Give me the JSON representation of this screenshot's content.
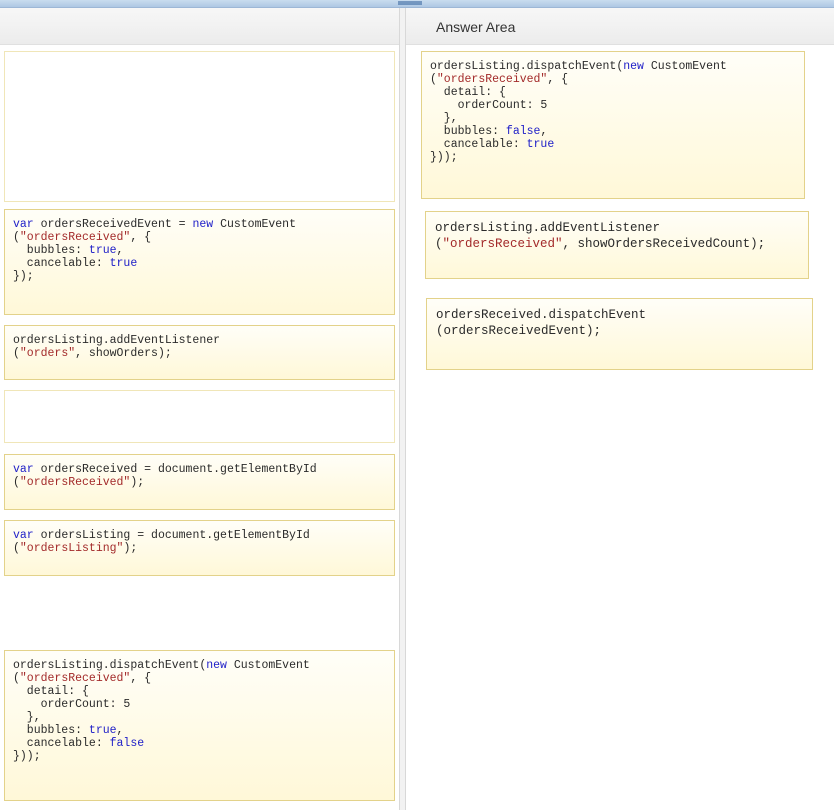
{
  "answer_area": {
    "title": "Answer Area"
  },
  "source_items": [
    {
      "lines": []
    },
    {
      "lines": [
        [
          [
            "var",
            "kw"
          ],
          [
            " ordersReceivedEvent = ",
            ""
          ],
          [
            "new",
            "kw"
          ],
          [
            " CustomEvent",
            ""
          ]
        ],
        [
          [
            "(",
            ""
          ],
          [
            "\"ordersReceived\"",
            "str"
          ],
          [
            ", {",
            ""
          ]
        ],
        [
          [
            "  bubbles: ",
            ""
          ],
          [
            "true",
            "kw"
          ],
          [
            ",",
            ""
          ]
        ],
        [
          [
            "  cancelable: ",
            ""
          ],
          [
            "true",
            "kw"
          ]
        ],
        [
          [
            "});",
            ""
          ]
        ]
      ]
    },
    {
      "lines": [
        [
          [
            "ordersListing.addEventListener",
            ""
          ]
        ],
        [
          [
            "(",
            ""
          ],
          [
            "\"orders\"",
            "str"
          ],
          [
            ", showOrders);",
            ""
          ]
        ]
      ]
    },
    {
      "lines": []
    },
    {
      "lines": [
        [
          [
            "var",
            "kw"
          ],
          [
            " ordersReceived = document.getElementById",
            ""
          ]
        ],
        [
          [
            "(",
            ""
          ],
          [
            "\"ordersReceived\"",
            "str"
          ],
          [
            ");",
            ""
          ]
        ]
      ]
    },
    {
      "lines": [
        [
          [
            "var",
            "kw"
          ],
          [
            " ordersListing = document.getElementById",
            ""
          ]
        ],
        [
          [
            "(",
            ""
          ],
          [
            "\"ordersListing\"",
            "str"
          ],
          [
            ");",
            ""
          ]
        ]
      ]
    },
    {
      "lines": []
    },
    {
      "lines": [
        [
          [
            "ordersListing.dispatchEvent(",
            ""
          ],
          [
            "new",
            "kw"
          ],
          [
            " CustomEvent",
            ""
          ]
        ],
        [
          [
            "(",
            ""
          ],
          [
            "\"ordersReceived\"",
            "str"
          ],
          [
            ", {",
            ""
          ]
        ],
        [
          [
            "  detail: {",
            ""
          ]
        ],
        [
          [
            "    orderCount: 5",
            ""
          ]
        ],
        [
          [
            "  },",
            ""
          ]
        ],
        [
          [
            "  bubbles: ",
            ""
          ],
          [
            "true",
            "kw"
          ],
          [
            ",",
            ""
          ]
        ],
        [
          [
            "  cancelable: ",
            ""
          ],
          [
            "false",
            "kw"
          ]
        ],
        [
          [
            "}));",
            ""
          ]
        ]
      ]
    }
  ],
  "answer_items": [
    {
      "lines": [
        [
          [
            "ordersListing.dispatchEvent(",
            ""
          ],
          [
            "new",
            "kw"
          ],
          [
            " CustomEvent",
            ""
          ]
        ],
        [
          [
            "(",
            ""
          ],
          [
            "\"ordersReceived\"",
            "str"
          ],
          [
            ", {",
            ""
          ]
        ],
        [
          [
            "  detail: {",
            ""
          ]
        ],
        [
          [
            "    orderCount: 5",
            ""
          ]
        ],
        [
          [
            "  },",
            ""
          ]
        ],
        [
          [
            "  bubbles: ",
            ""
          ],
          [
            "false",
            "kw"
          ],
          [
            ",",
            ""
          ]
        ],
        [
          [
            "  cancelable: ",
            ""
          ],
          [
            "true",
            "kw"
          ]
        ],
        [
          [
            "}));",
            ""
          ]
        ]
      ]
    },
    {
      "lines": [
        [
          [
            "ordersListing.addEventListener",
            ""
          ]
        ],
        [
          [
            "(",
            ""
          ],
          [
            "\"ordersReceived\"",
            "str"
          ],
          [
            ", showOrdersReceivedCount);",
            ""
          ]
        ]
      ]
    },
    {
      "lines": [
        [
          [
            "ordersReceived.dispatchEvent",
            ""
          ]
        ],
        [
          [
            "(ordersReceivedEvent);",
            ""
          ]
        ]
      ]
    }
  ]
}
